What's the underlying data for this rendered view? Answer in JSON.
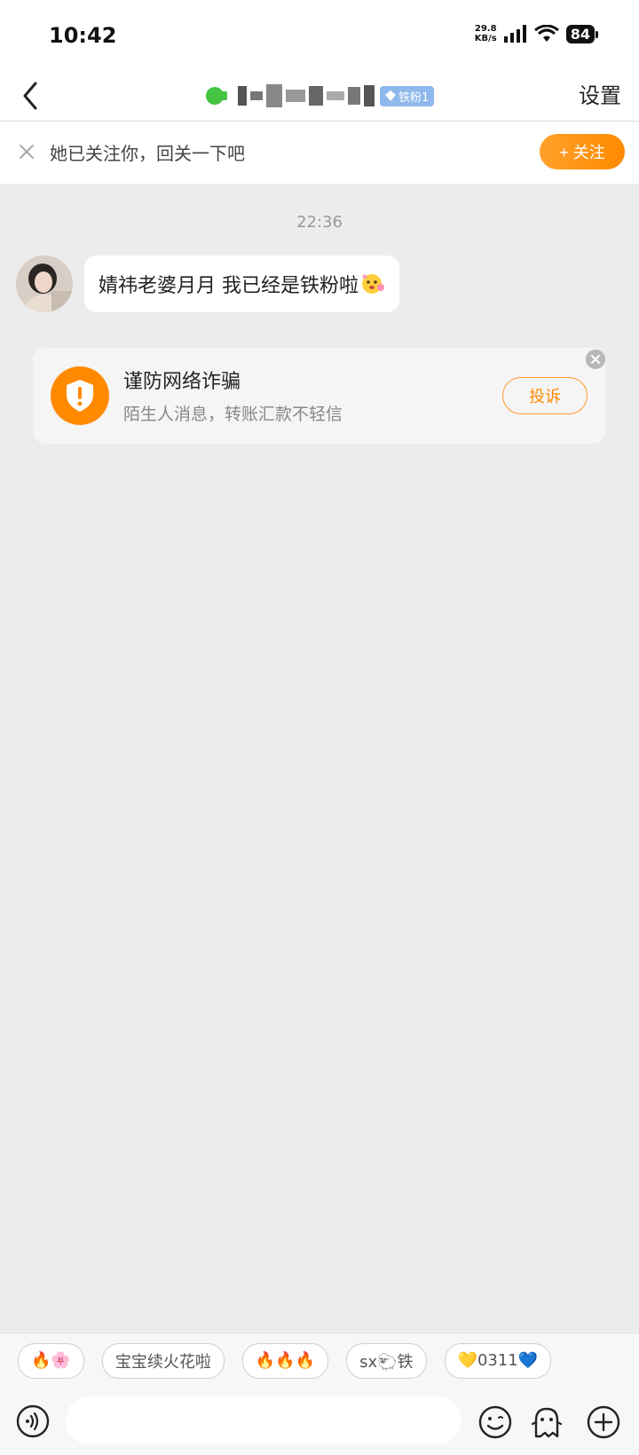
{
  "status_bar": {
    "time": "10:42",
    "net_speed_value": "29.8",
    "net_speed_unit": "KB/s",
    "battery": "84"
  },
  "header": {
    "fan_badge": "铁粉1",
    "settings_label": "设置"
  },
  "follow_bar": {
    "text": "她已关注你，回关一下吧",
    "follow_label": "+ 关注"
  },
  "chat": {
    "timestamp": "22:36",
    "messages": [
      {
        "text": "婧祎老婆月月 我已经是铁粉啦"
      }
    ]
  },
  "warning": {
    "title": "谨防网络诈骗",
    "subtitle": "陌生人消息，转账汇款不轻信",
    "complain_label": "投诉"
  },
  "quick_replies": [
    "🔥🌸",
    "宝宝续火花啦",
    "🔥🔥🔥",
    "sx🐑铁",
    "💛0311💙"
  ],
  "colors": {
    "accent": "#ff8a00",
    "online": "#44c442",
    "badge": "#8fb8ec"
  }
}
